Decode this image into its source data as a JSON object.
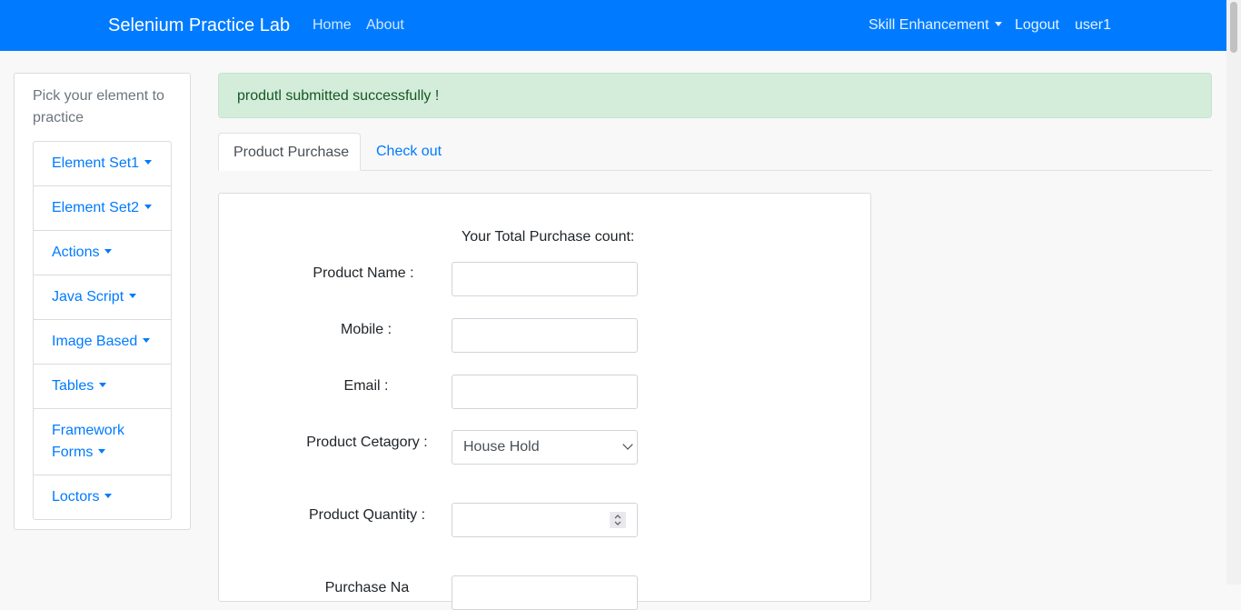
{
  "navbar": {
    "brand": "Selenium Practice Lab",
    "links": [
      "Home",
      "About"
    ],
    "skill_menu": "Skill Enhancement",
    "logout": "Logout",
    "user": "user1"
  },
  "sidebar": {
    "title": "Pick your element to practice",
    "items": [
      "Element Set1",
      "Element Set2",
      "Actions",
      "Java Script",
      "Image Based",
      "Tables",
      "Framework Forms",
      "Loctors"
    ]
  },
  "alert": {
    "message": "produtl submitted successfully !"
  },
  "tabs": [
    "Product Purchase",
    "Check out"
  ],
  "form": {
    "total_label": "Your Total Purchase count:",
    "product_name_label": "Product Name :",
    "product_name_value": "",
    "mobile_label": "Mobile :",
    "mobile_value": "",
    "email_label": "Email :",
    "email_value": "",
    "category_label": "Product Cetagory :",
    "category_selected": "House Hold",
    "quantity_label": "Product Quantity :",
    "quantity_value": "",
    "next_label_partial": "Purchase Na"
  },
  "colors": {
    "primary": "#007bff",
    "alert_bg": "#d4edda",
    "alert_text": "#155724"
  }
}
